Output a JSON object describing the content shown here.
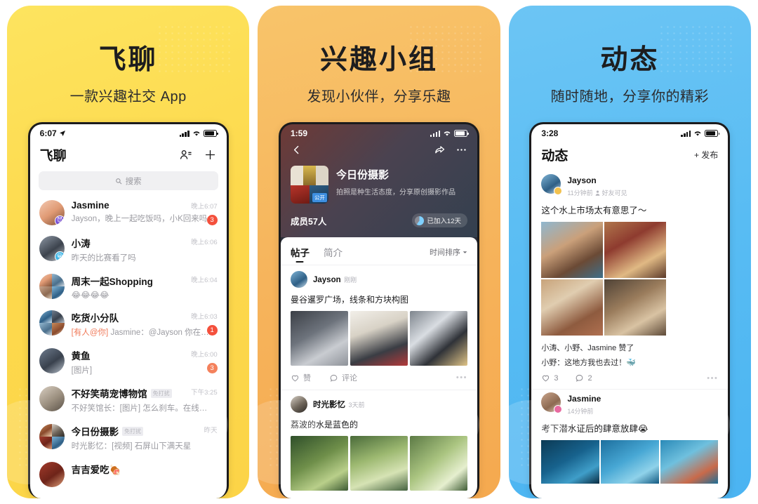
{
  "panels": [
    {
      "promo_title": "飞聊",
      "promo_sub": "一款兴趣社交 App",
      "status_time": "6:07",
      "nav_title": "飞聊",
      "search_placeholder": "搜索",
      "icons": {
        "contacts": "add-contact-icon",
        "plus": "plus-icon",
        "search": "search-icon"
      },
      "chats": [
        {
          "name": "Jasmine",
          "msg": "Jayson，晚上一起吃饭吗，小K回来吗",
          "time": "晚上6:07",
          "badge": "3",
          "tag": ""
        },
        {
          "name": "小涛",
          "msg": "昨天的比赛看了吗",
          "time": "晚上6:06",
          "badge": "",
          "tag": ""
        },
        {
          "name": "周末一起Shopping",
          "msg": "😂😂😂😂",
          "time": "晚上6:04",
          "badge": "",
          "tag": ""
        },
        {
          "name": "吃货小分队",
          "msg_at": "[有人@你]",
          "msg": "Jasmine：@Jayson 你在…",
          "time": "晚上6:03",
          "badge": "1",
          "tag": ""
        },
        {
          "name": "黄鱼",
          "msg": "[图片]",
          "time": "晚上6:00",
          "badge": "3",
          "tag": ""
        },
        {
          "name": "不好笑萌宠博物馆",
          "msg": "不好笑馆长：[图片] 怎么刹车。在线等，挺…",
          "time": "下午3:25",
          "badge": "",
          "tag": "免打扰"
        },
        {
          "name": "今日份摄影",
          "msg": "时光影忆：[视频] 石屏山下满天星",
          "time": "昨天",
          "badge": "",
          "tag": "免打扰"
        },
        {
          "name": "吉吉爱吃🍖",
          "msg": "",
          "time": "",
          "badge": "",
          "tag": ""
        }
      ]
    },
    {
      "promo_title": "兴趣小组",
      "promo_sub": "发现小伙伴，分享乐趣",
      "status_time": "1:59",
      "icons": {
        "back": "back-chevron-icon",
        "share": "share-icon",
        "more": "more-dots-icon"
      },
      "group": {
        "name": "今日份摄影",
        "desc": "拍照是种生活态度，分享原创摄影作品",
        "cover_tag": "公开",
        "members": "成员57人",
        "joined": "已加入12天"
      },
      "tabs": [
        {
          "label": "帖子",
          "active": true
        },
        {
          "label": "简介",
          "active": false
        }
      ],
      "sort_label": "时间排序",
      "posts": [
        {
          "author": "Jayson",
          "time": "刚刚",
          "text": "曼谷暹罗广场，线条和方块构图",
          "like_label": "赞",
          "comment_label": "评论"
        },
        {
          "author": "时光影忆",
          "time": "3天前",
          "text": "荔波的水是蓝色的"
        }
      ]
    },
    {
      "promo_title": "动态",
      "promo_sub": "随时随地，分享你的精彩",
      "status_time": "3:28",
      "nav_title": "动态",
      "publish_label": "+ 发布",
      "posts": [
        {
          "author": "Jayson",
          "time": "11分钟前",
          "visibility": "好友可见",
          "text": "这个水上市场太有意思了～",
          "likes": "小涛、小野、Jasmine 赞了",
          "comment": "小野：这地方我也去过！🐳",
          "like_count": "3",
          "comment_count": "2"
        },
        {
          "author": "Jasmine",
          "time": "14分钟前",
          "text": "考下潜水证后的肆意放肆😭"
        }
      ]
    }
  ],
  "colors": {
    "panel1": "#fdd94d",
    "panel2": "#f6b45c",
    "panel3": "#58bcf3",
    "badge": "#f4503c",
    "at_mention": "#f07a5a",
    "public_tag": "#3e8fe0"
  }
}
